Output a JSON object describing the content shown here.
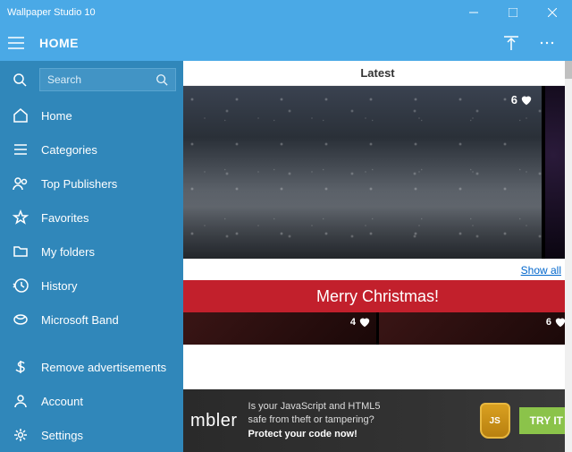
{
  "window": {
    "title": "Wallpaper Studio 10"
  },
  "header": {
    "title": "HOME"
  },
  "search": {
    "placeholder": "Search"
  },
  "nav": {
    "home": "Home",
    "categories": "Categories",
    "top_publishers": "Top Publishers",
    "favorites": "Favorites",
    "my_folders": "My folders",
    "history": "History",
    "microsoft_band": "Microsoft Band",
    "remove_ads": "Remove advertisements",
    "account": "Account",
    "settings": "Settings"
  },
  "main": {
    "section_title": "Latest",
    "hero_likes": "6",
    "show_all": "Show all",
    "banner": "Merry Christmas!",
    "thumb1_likes": "4",
    "thumb2_likes": "6"
  },
  "ad": {
    "brand": "mbler",
    "line1": "Is your JavaScript and HTML5",
    "line2": "safe from theft or tampering?",
    "line3": "Protect your code now!",
    "shield": "JS",
    "cta": "TRY IT"
  }
}
